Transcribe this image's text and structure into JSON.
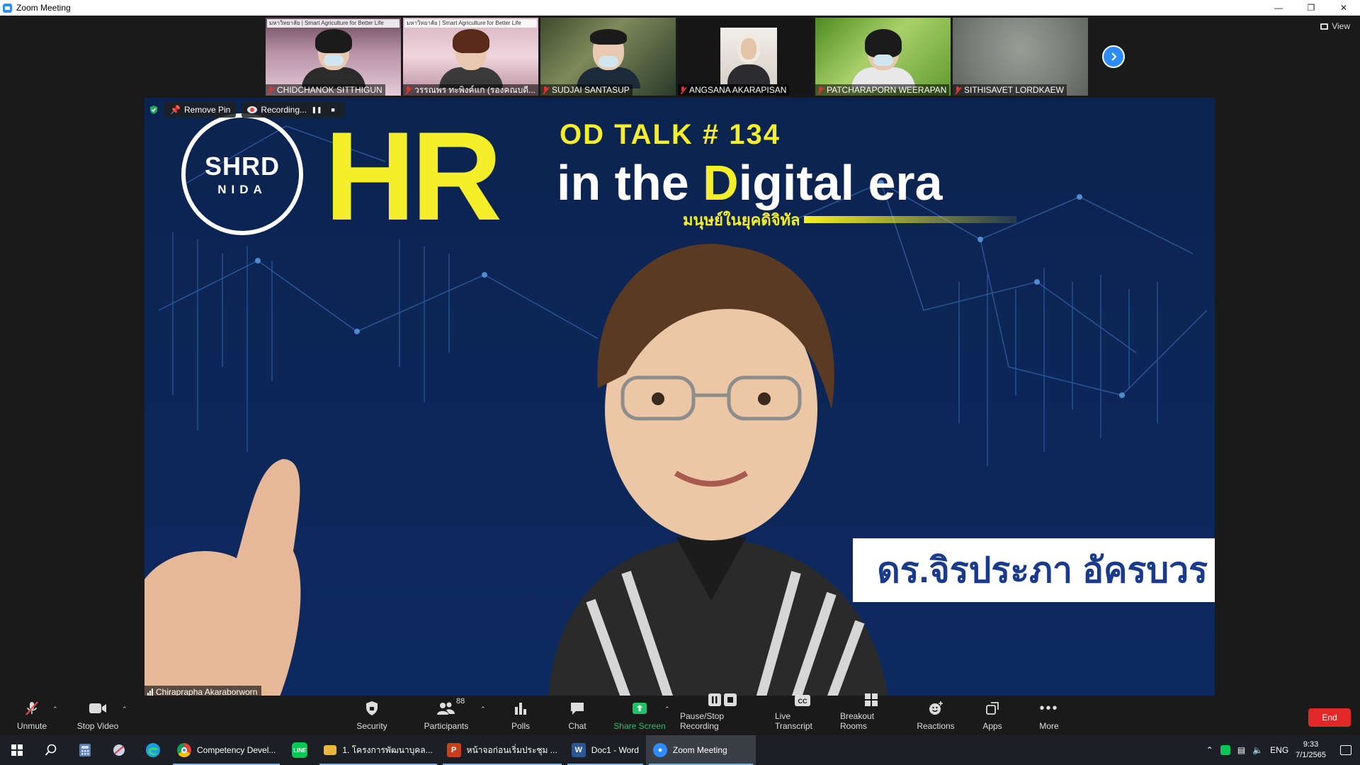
{
  "window": {
    "title": "Zoom Meeting"
  },
  "gallery": {
    "participants": [
      {
        "name": "CHIDCHANOK SITTHIGUN",
        "banner": "มหาวิทยาลัย | Smart Agriculture for Better Life",
        "bg": "#8d6a80"
      },
      {
        "name": "วรรณพร ทะพิงค์แก (รองคณบดี...",
        "banner": "มหาวิทยาลัย | Smart Agriculture for Better Life",
        "bg": "#c39aa5"
      },
      {
        "name": "SUDJAI SANTASUP",
        "banner": "",
        "bg": "#4f5a3a"
      },
      {
        "name": "ANGSANA AKARAPISAN",
        "banner": "",
        "bg": "#161616"
      },
      {
        "name": "PATCHARAPORN WEERAPAN",
        "banner": "",
        "bg": "#6f9f3a"
      },
      {
        "name": "SITHISAVET LORDKAEW",
        "banner": "",
        "bg": "#7d7f7a"
      }
    ],
    "view_label": "View"
  },
  "speaker": {
    "pin_label": "Remove Pin",
    "recording_label": "Recording...",
    "name": "Chiraprapha Akaraborworn",
    "slide": {
      "logo_main": "SHRD",
      "logo_sub": "NIDA",
      "hr": "HR",
      "od": "OD TALK # 134",
      "digital_a": "in the ",
      "digital_b": "D",
      "digital_c": "igital era",
      "sub_thai": "มนุษย์ในยุคดิจิทัล",
      "namecard": "ดร.จิรประภา   อัครบวร"
    }
  },
  "toolbar": {
    "unmute": "Unmute",
    "stop_video": "Stop Video",
    "security": "Security",
    "participants": "Participants",
    "participant_count": "88",
    "polls": "Polls",
    "chat": "Chat",
    "share_screen": "Share Screen",
    "pause_recording": "Pause/Stop Recording",
    "live_transcript": "Live Transcript",
    "breakout_rooms": "Breakout Rooms",
    "reactions": "Reactions",
    "apps": "Apps",
    "more": "More",
    "end": "End"
  },
  "taskbar": {
    "apps": [
      {
        "label": "Competency Devel...",
        "icon": "chrome-icon",
        "color": "#db4437"
      },
      {
        "label": "1. โครงการพัฒนาบุคล...",
        "icon": "folder-icon",
        "color": "#e8b73c"
      },
      {
        "label": "หน้าจอก่อนเริ่มประชุม ...",
        "icon": "powerpoint-icon",
        "color": "#c4411f"
      },
      {
        "label": "Doc1 - Word",
        "icon": "word-icon",
        "color": "#2b5797"
      },
      {
        "label": "Zoom Meeting",
        "icon": "zoom-icon",
        "color": "#2d8cff"
      }
    ],
    "lang": "ENG",
    "time": "9:33",
    "date": "7/1/2565"
  }
}
